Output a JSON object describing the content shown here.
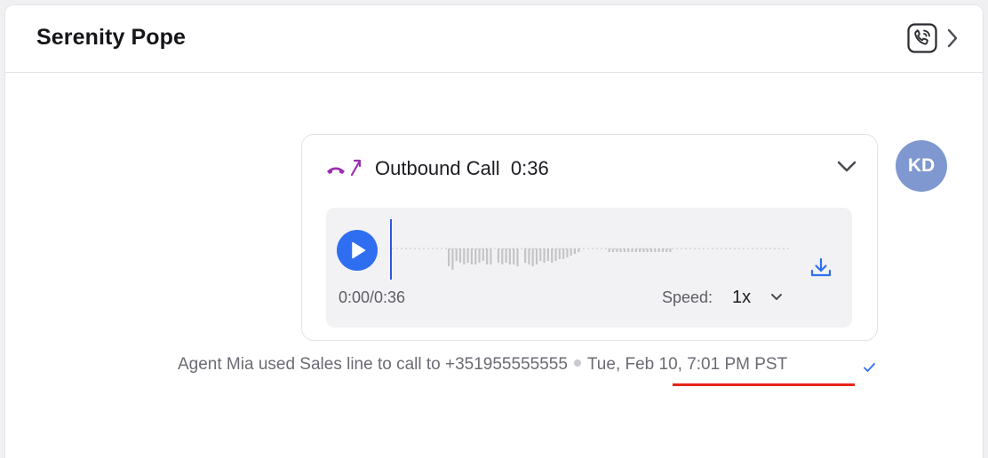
{
  "header": {
    "contact_name": "Serenity Pope"
  },
  "call_card": {
    "direction_label": "Outbound Call",
    "duration": "0:36",
    "icon": "outbound-call-icon",
    "accent_color": "#9b2fb0"
  },
  "player": {
    "time_display": "0:00/0:36",
    "speed_label": "Speed:",
    "speed_value": "1x",
    "progress": 0,
    "play_color": "#2f6ef0"
  },
  "avatar": {
    "initials": "KD",
    "color": "#7f98cf"
  },
  "meta": {
    "description": "Agent Mia used Sales line to call to +351955555555",
    "timestamp": "Tue, Feb 10, 7:01 PM PST",
    "status_icon": "check-icon"
  }
}
